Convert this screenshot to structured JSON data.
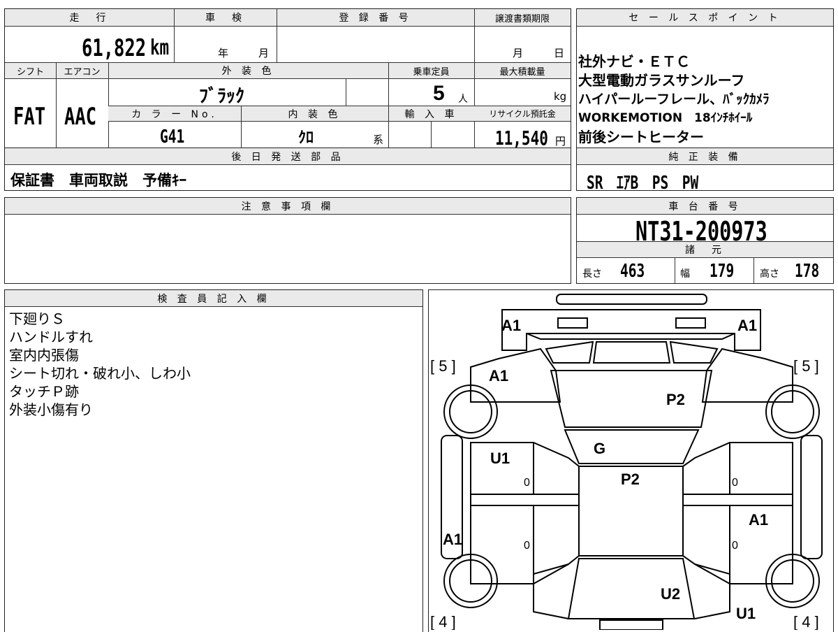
{
  "vehicle": {
    "mileage_label": "走　行",
    "mileage_value": "61,822",
    "mileage_unit": "km",
    "inspection_label": "車　検",
    "inspection_year": "年",
    "inspection_month": "月",
    "registration_label": "登 録 番 号",
    "transfer_label": "譲渡書類期限",
    "transfer_month": "月",
    "transfer_day": "日",
    "shift_label": "シフト",
    "shift_value": "FAT",
    "aircon_label": "エアコン",
    "aircon_value": "AAC",
    "exterior_label": "外 装 色",
    "exterior_value": "ﾌﾞﾗｯｸ",
    "capacity_label": "乗車定員",
    "capacity_value": "5",
    "capacity_unit": "人",
    "maxload_label": "最大積載量",
    "maxload_unit": "kg",
    "color_no_label": "カ ラ ー No.",
    "color_no_value": "G41",
    "interior_label": "内 装 色",
    "interior_value": "ｸﾛ",
    "interior_unit": "系",
    "import_label": "輸 入 車",
    "recycle_label": "リサイクル預託金",
    "recycle_value": "11,540",
    "recycle_unit": "円"
  },
  "later_parts": {
    "label": "後 日 発 送 部 品",
    "value": "保証書　車両取説　予備ｷｰ"
  },
  "caution": {
    "label": "注 意 事 項 欄"
  },
  "sales_points": {
    "label": "セ ー ル ス ポ イ ン ト",
    "lines": [
      "社外ナビ・ＥＴＣ",
      "大型電動ガラスサンルーフ",
      "ハイパールーフレール、ﾊﾞｯｸｶﾒﾗ",
      "WORKEMOTION　18ｲﾝﾁﾎｲｰﾙ",
      "前後シートヒーター"
    ]
  },
  "equipment": {
    "label": "純 正 装 備",
    "value": "SR　ｴｱB　PS　PW"
  },
  "chassis": {
    "label": "車 台 番 号",
    "value": "NT31-200973"
  },
  "specs": {
    "label": "諸　元",
    "length_label": "長さ",
    "length_value": "463",
    "width_label": "幅",
    "width_value": "179",
    "height_label": "高さ",
    "height_value": "178"
  },
  "inspector": {
    "label": "検 査 員 記 入 欄",
    "notes": [
      "下廻りＳ",
      "ハンドルすれ",
      "室内内張傷",
      "シート切れ・破れ小、しわ小",
      "タッチＰ跡",
      "外装小傷有り"
    ]
  },
  "diagram": {
    "marks": {
      "front_left": "A1",
      "front_right": "A1",
      "fender_left": "A1",
      "bonnet": "P2",
      "windshield": "G",
      "roof": "P2",
      "door_front_left": "U1",
      "door_front_left_zero": "0",
      "door_rear_left_zero": "0",
      "door_front_right_zero": "0",
      "door_rear_right_zero": "0",
      "door_rear_right": "A1",
      "rear_left": "A1",
      "rear_center": "U2",
      "rear_right": "U1"
    },
    "tires": {
      "front_left": "[ 5 ]",
      "front_right": "[ 5 ]",
      "rear_left": "[ 4 ]",
      "rear_right": "[ 4 ]"
    }
  }
}
